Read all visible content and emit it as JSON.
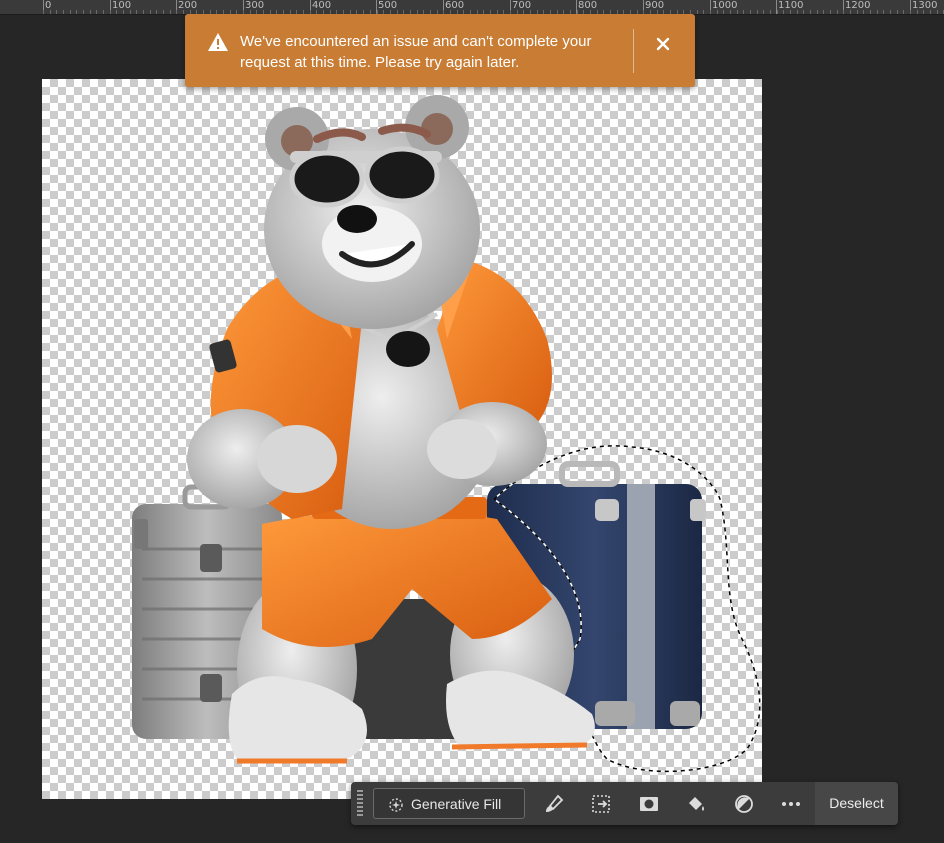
{
  "ruler": {
    "labels": [
      "0",
      "100",
      "200",
      "300",
      "400",
      "500",
      "600",
      "700",
      "800",
      "900",
      "1000",
      "1100",
      "1200",
      "1300"
    ]
  },
  "toast": {
    "icon": "warning-icon",
    "message": "We've encountered an issue and can't complete your request at this time. Please try again later.",
    "close_icon": "close-icon",
    "background_color": "#c97c34"
  },
  "canvas": {
    "background": "transparent-checkerboard",
    "content": "bear-with-luggage-image",
    "selection": "marching-ants-around-blue-suitcase"
  },
  "taskbar": {
    "generative_fill_label": "Generative Fill",
    "tools": [
      {
        "icon": "brush-icon"
      },
      {
        "icon": "transform-icon"
      },
      {
        "icon": "mask-icon"
      },
      {
        "icon": "fill-bucket-icon"
      },
      {
        "icon": "adjustment-icon"
      },
      {
        "icon": "more-options-icon"
      }
    ],
    "deselect_label": "Deselect"
  }
}
